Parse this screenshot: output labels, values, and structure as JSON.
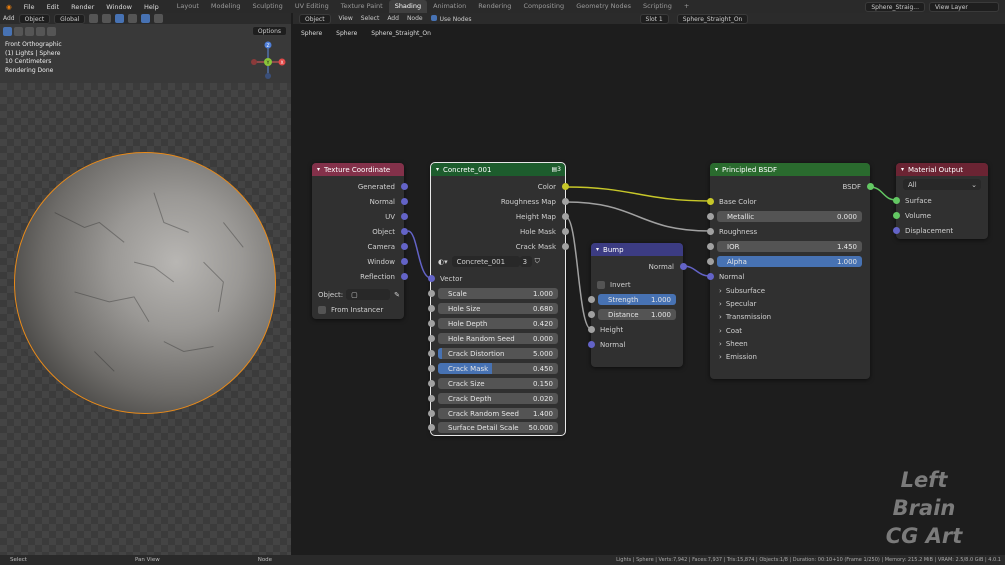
{
  "menu": {
    "items": [
      "File",
      "Edit",
      "Render",
      "Window",
      "Help"
    ],
    "workspaces": [
      "Layout",
      "Modeling",
      "Sculpting",
      "UV Editing",
      "Texture Paint",
      "Shading",
      "Animation",
      "Rendering",
      "Compositing",
      "Geometry Nodes",
      "Scripting"
    ],
    "active_workspace": "Shading",
    "add_workspace": "+",
    "scene": "Sphere_Straig...",
    "view_layer": "View Layer"
  },
  "viewport": {
    "toolbar": {
      "add": "Add",
      "mode": "Object",
      "orientation": "Global",
      "options": "Options"
    },
    "info": [
      "Front Orthographic",
      "(1) Lights | Sphere",
      "10 Centimeters",
      "Rendering Done"
    ],
    "gizmo": {
      "z": "Z",
      "x": "X",
      "y": "Y"
    }
  },
  "editor": {
    "toolbar": {
      "object": "Object",
      "view": "View",
      "select": "Select",
      "add": "Add",
      "node": "Node",
      "use_nodes": "Use Nodes",
      "slot": "Slot 1",
      "material": "Sphere_Straight_On"
    },
    "breadcrumb": [
      "Sphere",
      "Sphere",
      "Sphere_Straight_On"
    ]
  },
  "nodes": {
    "texcoord": {
      "title": "Texture Coordinate",
      "outputs": [
        "Generated",
        "Normal",
        "UV",
        "Object",
        "Camera",
        "Window",
        "Reflection"
      ],
      "object_label": "Object:",
      "from_instancer": "From Instancer"
    },
    "concrete": {
      "title": "Concrete_001",
      "user_count": "3",
      "outputs": [
        "Color",
        "Roughness Map",
        "Height Map",
        "Hole Mask",
        "Crack Mask"
      ],
      "datablock": "Concrete_001",
      "datablock_users": "3",
      "vector": "Vector",
      "fields": [
        {
          "label": "Scale",
          "value": "1.000"
        },
        {
          "label": "Hole Size",
          "value": "0.680"
        },
        {
          "label": "Hole Depth",
          "value": "0.420"
        },
        {
          "label": "Hole Random Seed",
          "value": "0.000"
        },
        {
          "label": "Crack Distortion",
          "value": "5.000"
        },
        {
          "label": "Crack Mask",
          "value": "0.450"
        },
        {
          "label": "Crack Size",
          "value": "0.150"
        },
        {
          "label": "Crack Depth",
          "value": "0.020"
        },
        {
          "label": "Crack Random Seed",
          "value": "1.400"
        },
        {
          "label": "Surface Detail Scale",
          "value": "50.000"
        }
      ]
    },
    "bump": {
      "title": "Bump",
      "output": "Normal",
      "invert": "Invert",
      "strength_label": "Strength",
      "strength": "1.000",
      "distance_label": "Distance",
      "distance": "1.000",
      "height": "Height",
      "normal": "Normal"
    },
    "bsdf": {
      "title": "Principled BSDF",
      "output": "BSDF",
      "base_color": "Base Color",
      "metallic_label": "Metallic",
      "metallic": "0.000",
      "roughness": "Roughness",
      "ior_label": "IOR",
      "ior": "1.450",
      "alpha_label": "Alpha",
      "alpha": "1.000",
      "normal": "Normal",
      "panels": [
        "Subsurface",
        "Specular",
        "Transmission",
        "Coat",
        "Sheen",
        "Emission"
      ]
    },
    "output": {
      "title": "Material Output",
      "target": "All",
      "inputs": [
        "Surface",
        "Volume",
        "Displacement"
      ]
    }
  },
  "watermark": [
    "Left Brain",
    "CG Art"
  ],
  "status": {
    "select": "Select",
    "pan": "Pan View",
    "node": "Node",
    "stats": "Lights | Sphere | Verts:7,942 | Faces:7,937 | Tris:15,874 | Objects:1/8 | Duration: 00:10+10 (Frame 1/250) | Memory: 215.2 MiB | VRAM: 2.5/8.0 GiB | 4.0.1"
  },
  "colors": {
    "selection_outline": "#e88a1a",
    "accent_blue": "#4772b3",
    "socket_color": "#c7c729",
    "socket_float": "#a1a1a1",
    "socket_vector": "#6363c7",
    "socket_shader": "#63c763"
  }
}
